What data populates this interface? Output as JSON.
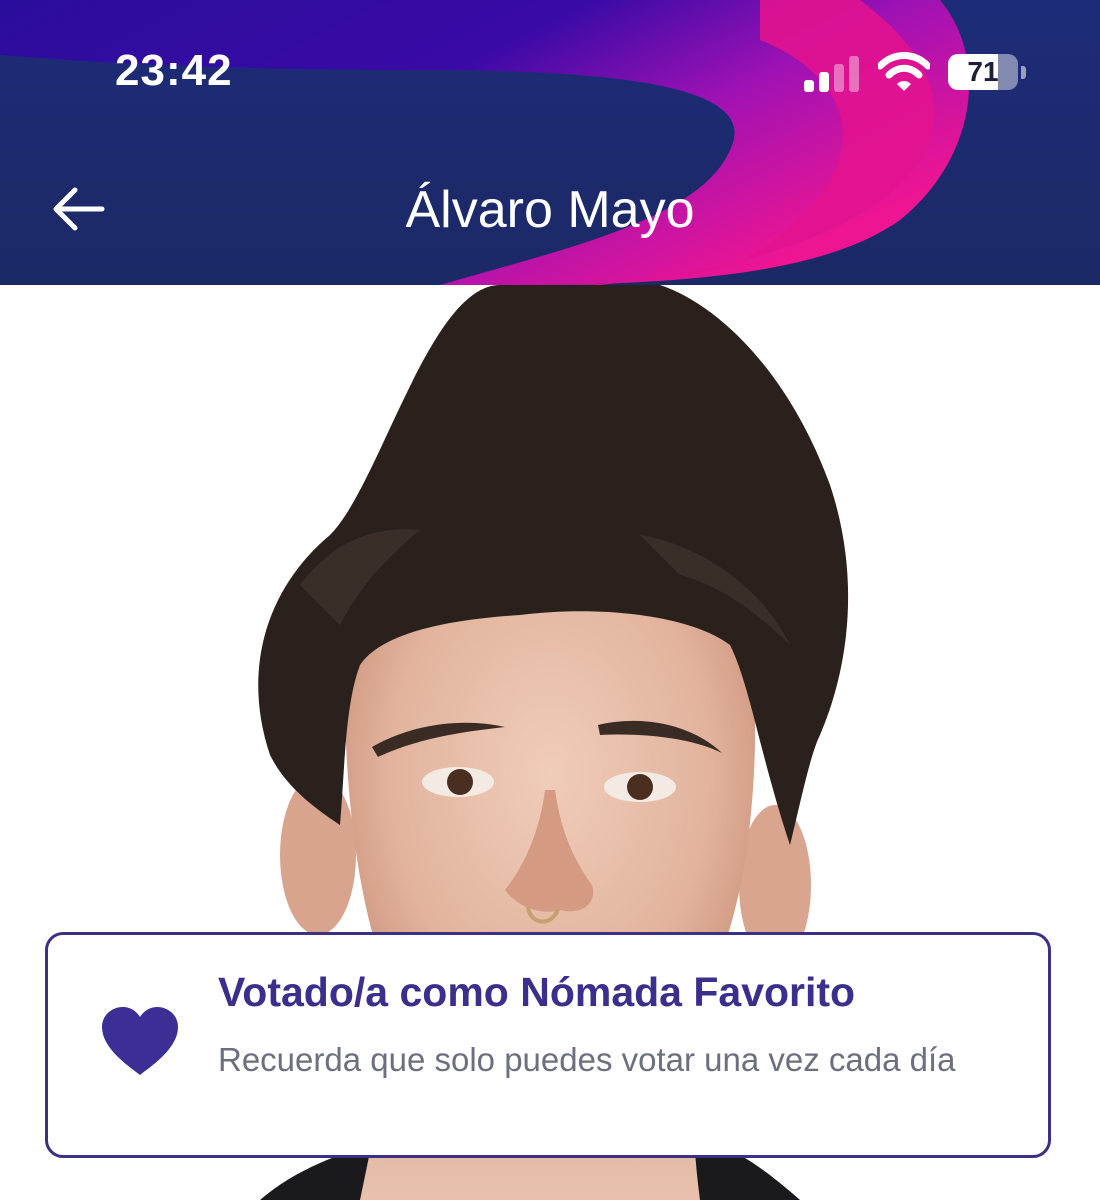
{
  "status_bar": {
    "time": "23:42",
    "battery_level": "71",
    "battery_fraction": 0.71,
    "signal_bars_active": 2,
    "signal_bars_total": 4
  },
  "header": {
    "title": "Álvaro Mayo",
    "back_icon": "arrow-left-icon"
  },
  "photo": {
    "subject": "contestant-portrait"
  },
  "vote_card": {
    "icon": "heart-icon",
    "title": "Votado/a como Nómada Favorito",
    "subtitle": "Recuerda que solo puedes votar una vez cada día"
  },
  "colors": {
    "header_navy": "#1c2a6e",
    "header_indigo": "#2a0d9c",
    "header_magenta": "#e0119b",
    "accent_purple": "#3b2f8e",
    "subtitle_gray": "#6c6f7d"
  }
}
